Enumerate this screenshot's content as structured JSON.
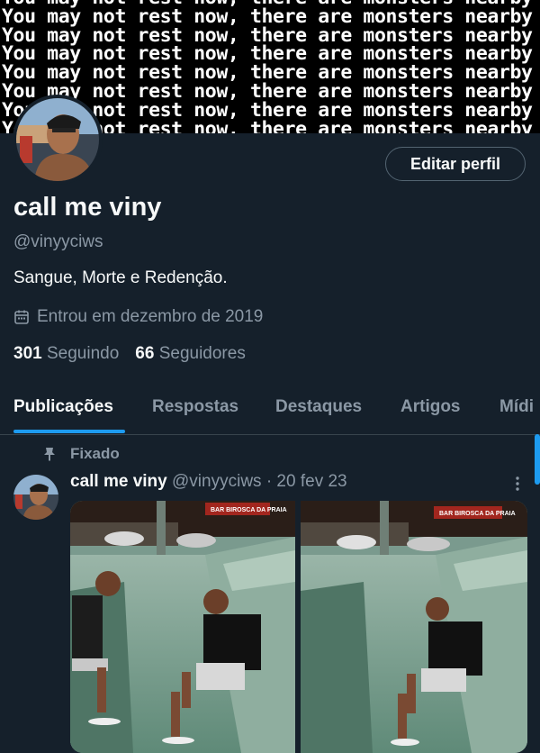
{
  "banner": {
    "line": "You may not rest now, there are monsters nearby"
  },
  "profile": {
    "name": "call me viny",
    "handle": "@vinyyciws",
    "bio": "Sangue, Morte e Redenção.",
    "joined": "Entrou em dezembro de 2019",
    "following_count": "301",
    "following_label": "Seguindo",
    "followers_count": "66",
    "followers_label": "Seguidores",
    "edit_button": "Editar perfil"
  },
  "tabs": [
    {
      "label": "Publicações"
    },
    {
      "label": "Respostas"
    },
    {
      "label": "Destaques"
    },
    {
      "label": "Artigos"
    },
    {
      "label": "Mídi"
    }
  ],
  "pinned_post": {
    "pinned_label": "Fixado",
    "author_name": "call me viny",
    "author_handle": "@vinyyciws",
    "date": "· 20 fev 23",
    "media_sign_text": "BAR BIROSCA DA PRAIA"
  },
  "colors": {
    "background": "#15202b",
    "accent": "#1d9bf0",
    "secondary_text": "#8b98a5"
  }
}
